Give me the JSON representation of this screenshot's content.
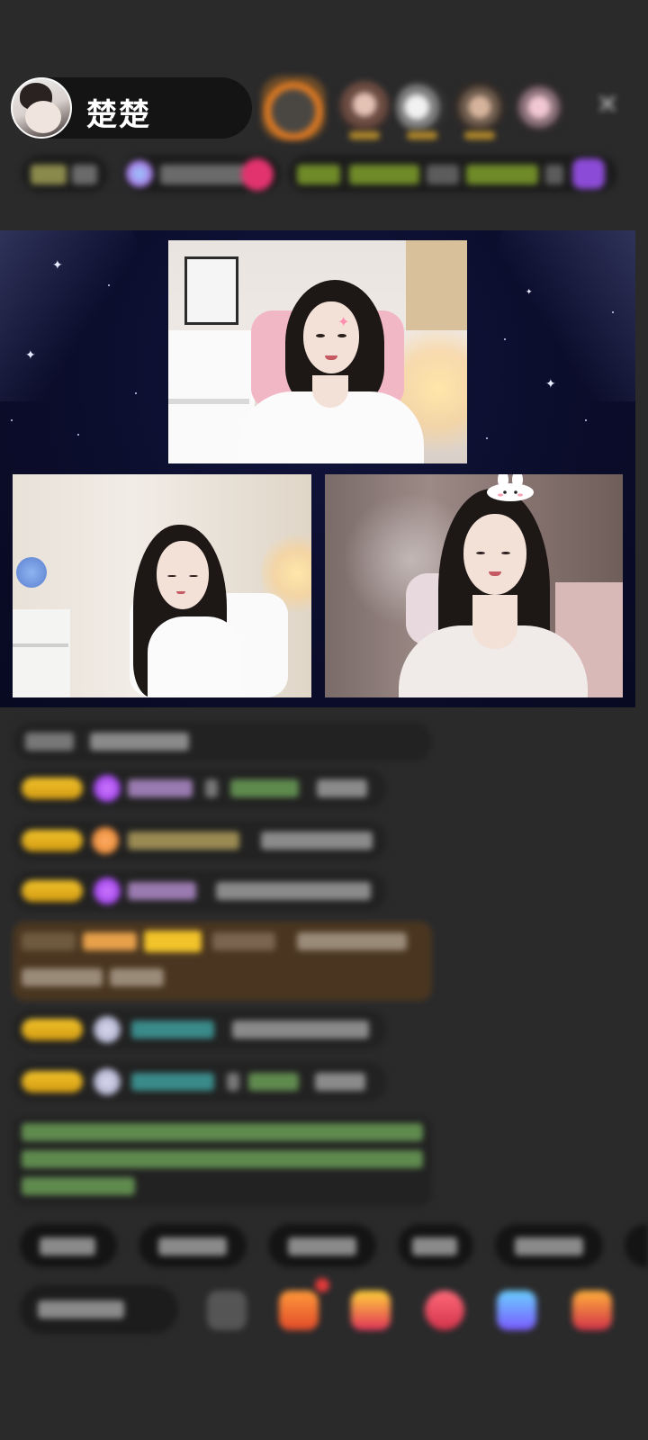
{
  "host": {
    "name": "楚楚"
  },
  "header": {
    "close_glyph": "✕",
    "viewers": [
      {
        "name": "viewer-avatar-1"
      },
      {
        "name": "viewer-avatar-2"
      },
      {
        "name": "viewer-avatar-3"
      },
      {
        "name": "viewer-avatar-4"
      },
      {
        "name": "viewer-avatar-5"
      }
    ]
  },
  "colors": {
    "background": "#2a2a2b",
    "stage": "#0b0d2c",
    "badge_gold": "#f2c32a",
    "tag_green": "#6f8a28",
    "system_msg": "#4a3620"
  },
  "stage": {
    "cameras": [
      "camera-top",
      "camera-left",
      "camera-right"
    ]
  },
  "icons": [
    "close-icon",
    "gem-icon",
    "gift-icon",
    "emoji-icon",
    "more-icon"
  ]
}
